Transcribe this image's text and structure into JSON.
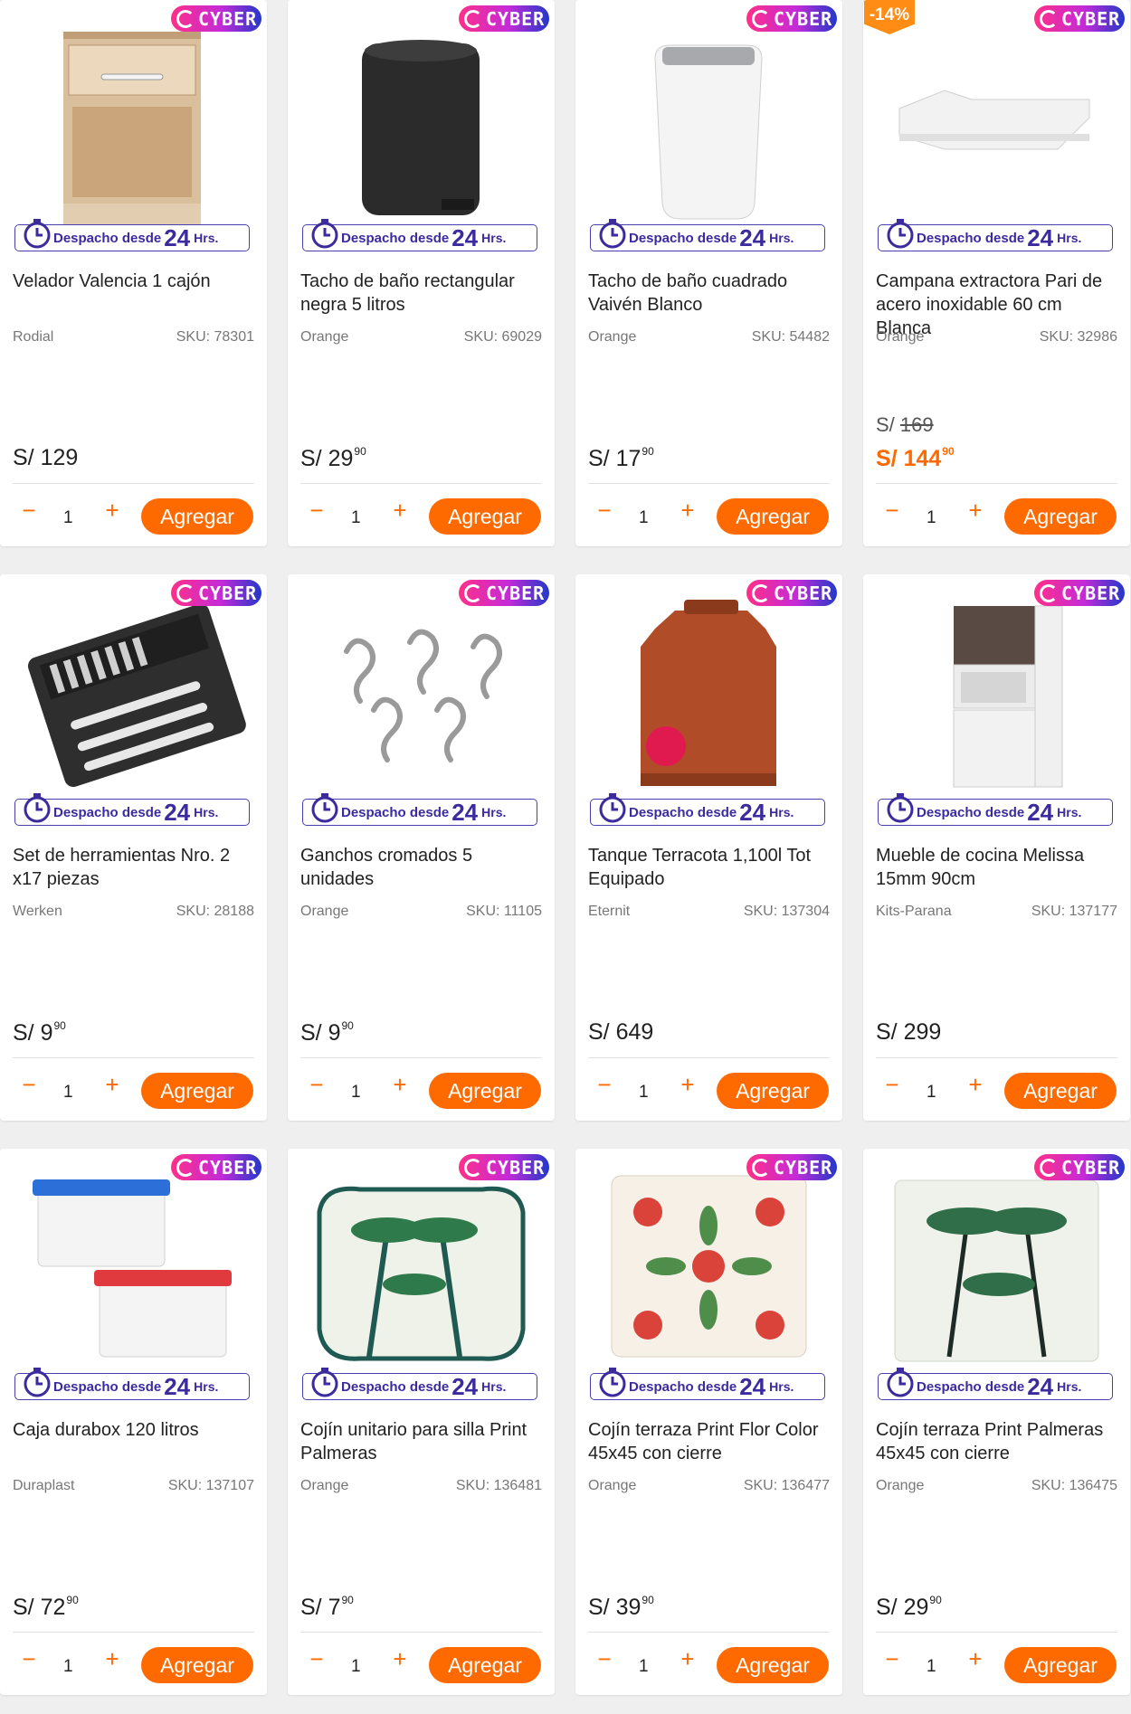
{
  "badge": {
    "cyber_label": "CYBER",
    "despacho_prefix": "Despacho desde",
    "despacho_number": "24",
    "despacho_unit": "Hrs."
  },
  "colors": {
    "accent": "#ff6a00",
    "despacho": "#3b2b9e",
    "cyber_start": "#ff2f88",
    "cyber_end": "#2338c9"
  },
  "labels": {
    "add_button": "Agregar",
    "minus": "−",
    "plus": "+",
    "currency": "S/"
  },
  "products": [
    {
      "title": "Velador Valencia 1 cajón",
      "brand": "Rodial",
      "sku": "SKU: 78301",
      "price_int": "129",
      "price_dec": "",
      "old_price": "",
      "discount": "",
      "qty": "1",
      "image": "nightstand"
    },
    {
      "title": "Tacho de baño rectangular negra 5 litros",
      "brand": "Orange",
      "sku": "SKU: 69029",
      "price_int": "29",
      "price_dec": "90",
      "old_price": "",
      "discount": "",
      "qty": "1",
      "image": "black-bin"
    },
    {
      "title": "Tacho de baño cuadrado Vaivén Blanco",
      "brand": "Orange",
      "sku": "SKU: 54482",
      "price_int": "17",
      "price_dec": "90",
      "old_price": "",
      "discount": "",
      "qty": "1",
      "image": "white-bin"
    },
    {
      "title": "Campana extractora Pari de acero inoxidable 60 cm Blanca",
      "brand": "Orange",
      "sku": "SKU: 32986",
      "price_int": "144",
      "price_dec": "90",
      "old_price": "169",
      "discount": "-14%",
      "qty": "1",
      "image": "range-hood"
    },
    {
      "title": "Set de herramientas Nro. 2 x17 piezas",
      "brand": "Werken",
      "sku": "SKU: 28188",
      "price_int": "9",
      "price_dec": "90",
      "old_price": "",
      "discount": "",
      "qty": "1",
      "image": "tool-case"
    },
    {
      "title": "Ganchos cromados 5 unidades",
      "brand": "Orange",
      "sku": "SKU: 11105",
      "price_int": "9",
      "price_dec": "90",
      "old_price": "",
      "discount": "",
      "qty": "1",
      "image": "s-hooks"
    },
    {
      "title": "Tanque Terracota 1,100l Tot Equipado",
      "brand": "Eternit",
      "sku": "SKU: 137304",
      "price_int": "649",
      "price_dec": "",
      "old_price": "",
      "discount": "",
      "qty": "1",
      "image": "water-tank"
    },
    {
      "title": "Mueble de cocina Melissa 15mm 90cm",
      "brand": "Kits-Parana",
      "sku": "SKU: 137177",
      "price_int": "299",
      "price_dec": "",
      "old_price": "",
      "discount": "",
      "qty": "1",
      "image": "kitchen-cabinet"
    },
    {
      "title": "Caja durabox 120 litros",
      "brand": "Duraplast",
      "sku": "SKU: 137107",
      "price_int": "72",
      "price_dec": "90",
      "old_price": "",
      "discount": "",
      "qty": "1",
      "image": "storage-boxes"
    },
    {
      "title": "Cojín unitario para silla Print Palmeras",
      "brand": "Orange",
      "sku": "SKU: 136481",
      "price_int": "7",
      "price_dec": "90",
      "old_price": "",
      "discount": "",
      "qty": "1",
      "image": "chair-cushion"
    },
    {
      "title": "Cojín terraza Print Flor Color 45x45 con cierre",
      "brand": "Orange",
      "sku": "SKU: 136477",
      "price_int": "39",
      "price_dec": "90",
      "old_price": "",
      "discount": "",
      "qty": "1",
      "image": "floral-cushion"
    },
    {
      "title": "Cojín terraza Print Palmeras 45x45 con cierre",
      "brand": "Orange",
      "sku": "SKU: 136475",
      "price_int": "29",
      "price_dec": "90",
      "old_price": "",
      "discount": "",
      "qty": "1",
      "image": "palm-cushion"
    }
  ]
}
